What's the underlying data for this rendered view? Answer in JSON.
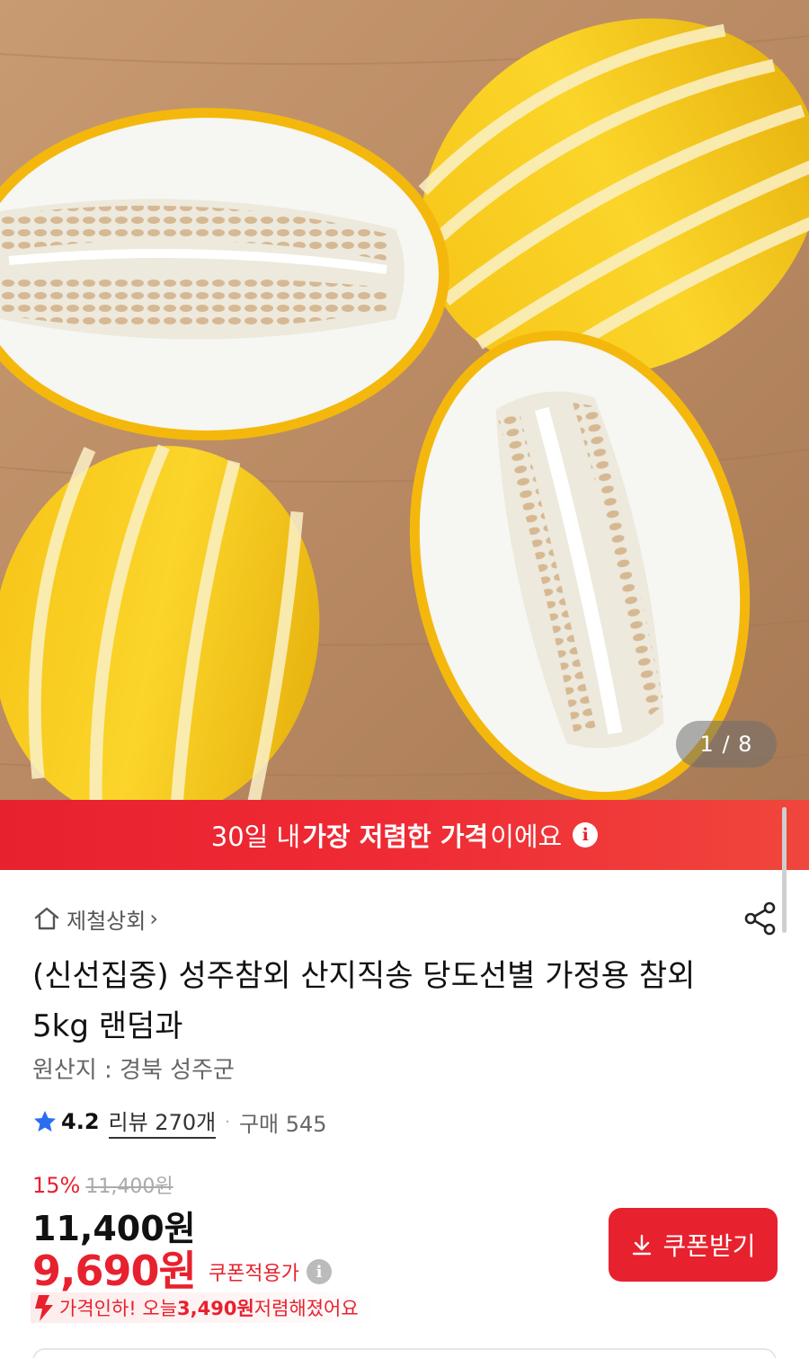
{
  "gallery": {
    "current_page": 1,
    "total_pages": 8,
    "indicator": "1 / 8",
    "image_subject": "korean-melon-chamoe-photo"
  },
  "promo_banner": {
    "pre": "30일 내 ",
    "strong": "가장 저렴한 가격",
    "post": "이에요",
    "info_icon": "i",
    "bg_color": "#e8212e"
  },
  "store": {
    "icon": "home-icon",
    "name": "제철상회",
    "chevron": "›"
  },
  "product": {
    "title": "(신선집중) 성주참외 산지직송 당도선별 가정용 참외 5kg 랜덤과",
    "origin": "원산지 : 경북 성주군"
  },
  "rating": {
    "score": "4.2",
    "reviews": "리뷰 270개",
    "separator": "·",
    "purchases": "구매 545"
  },
  "price": {
    "discount_pct": "15%",
    "original": "11,400원",
    "current": "11,400원",
    "coupon_price": "9,690원",
    "coupon_label": "쿠폰적용가",
    "coupon_info": "i",
    "accent_color": "#e8212e"
  },
  "price_drop": {
    "prefix": "가격인하! 오늘 ",
    "amount": "3,490원",
    "suffix": " 저렴해졌어요"
  },
  "coupon_button": {
    "label": "쿠폰받기",
    "icon": "download-icon"
  }
}
